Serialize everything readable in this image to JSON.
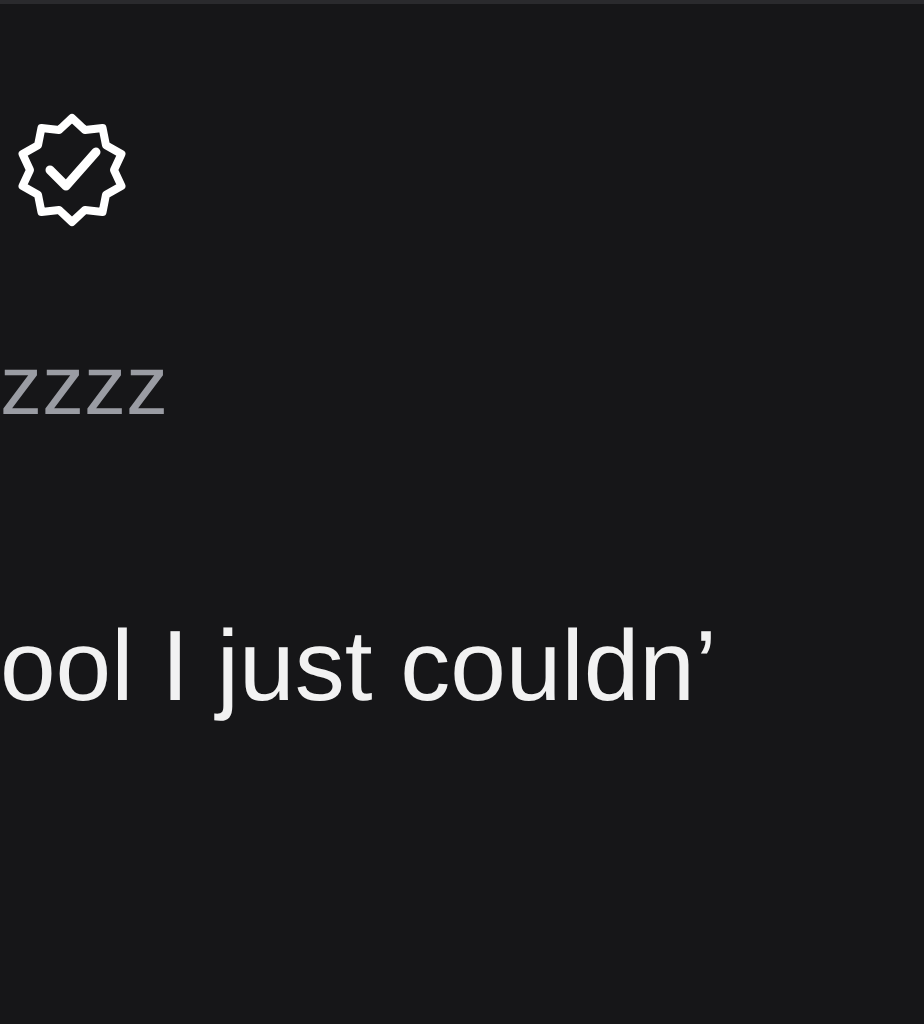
{
  "post": {
    "verified": true,
    "handle": "zzzz",
    "text": "ool I just couldn’"
  }
}
